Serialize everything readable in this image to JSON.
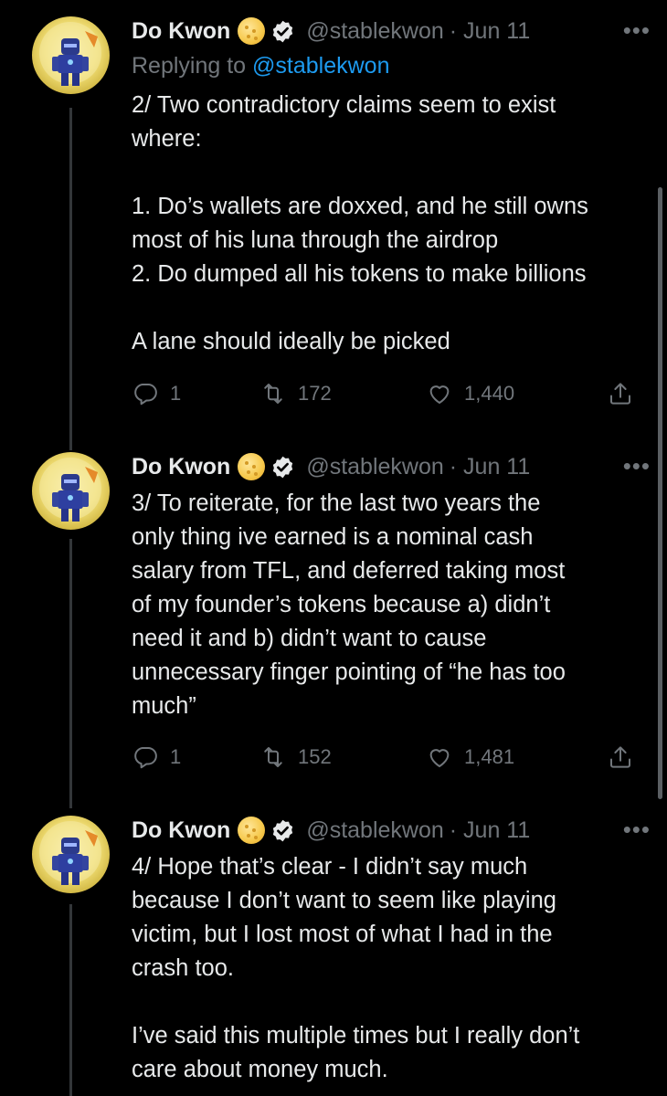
{
  "tweets": [
    {
      "name": "Do Kwon",
      "handle": "@stablekwon",
      "date": "· Jun 11",
      "replying_prefix": "Replying to ",
      "replying_handle": "@stablekwon",
      "text": "2/ Two contradictory claims seem to exist\nwhere:\n\n1. Do’s wallets are doxxed, and he still owns\nmost of his luna through the airdrop\n2. Do dumped all his tokens to make billions\n\nA lane should ideally be picked",
      "replies": "1",
      "retweets": "172",
      "likes": "1,440"
    },
    {
      "name": "Do Kwon",
      "handle": "@stablekwon",
      "date": "· Jun 11",
      "text": "3/ To reiterate, for the last two years the\nonly thing ive earned is a nominal cash\nsalary from TFL, and deferred taking most\nof my founder’s tokens because a) didn’t\nneed it and b) didn’t want to cause\nunnecessary finger pointing of “he has too\nmuch”",
      "replies": "1",
      "retweets": "152",
      "likes": "1,481"
    },
    {
      "name": "Do Kwon",
      "handle": "@stablekwon",
      "date": "· Jun 11",
      "text": "4/ Hope that’s clear - I didn’t say much\nbecause I don’t want to seem like playing\nvictim, but I lost most of what I had in the\ncrash too.\n\nI’ve said this multiple times but I really don’t\ncare about money much."
    }
  ],
  "icons": {
    "name_emoji": "full-moon-emoji",
    "verified": "verified-badge-icon",
    "more": "more-dots-icon",
    "reply": "reply-icon",
    "retweet": "retweet-icon",
    "like": "heart-icon",
    "share": "share-icon"
  },
  "colors": {
    "background": "#000000",
    "text": "#e7e9ea",
    "muted": "#71767b",
    "link": "#1d9bf0"
  }
}
